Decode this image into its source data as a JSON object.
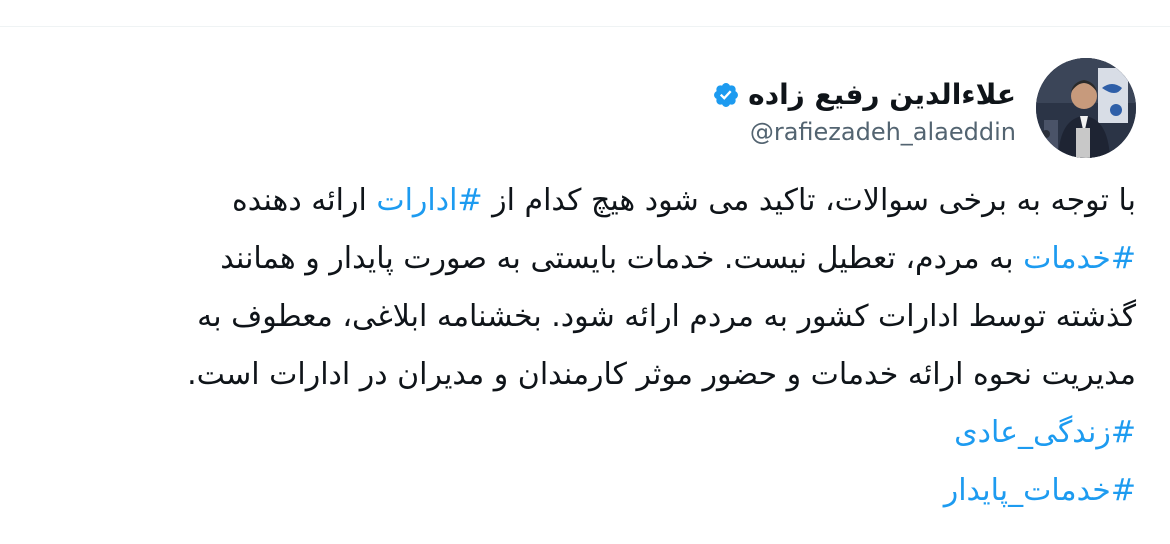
{
  "author": {
    "name": "علاءالدین رفیع زاده",
    "handle": "@rafiezadeh_alaeddin",
    "verified": true,
    "avatar_icon": "profile-photo"
  },
  "colors": {
    "link": "#1d9bf0",
    "verified_badge": "#1d9bf0",
    "handle": "#536471",
    "text": "#0f1419"
  },
  "tweet": {
    "line1": {
      "a": "با توجه به برخی سوالات، تاکید می شود هیچ کدام از ",
      "tag": "#ادارات",
      "b": " ارائه دهنده"
    },
    "line2": {
      "tag": "#خدمات",
      "b": " به مردم، تعطیل نیست. خدمات بایستی به صورت پایدار و همانند"
    },
    "line3": "گذشته توسط ادارات کشور به مردم ارائه شود. بخشنامه ابلاغی، معطوف به",
    "line4": "مدیریت نحوه ارائه خدمات و حضور موثر کارمندان و مدیران در ادارات است.",
    "hashtag1": "#زندگی_عادی",
    "hashtag2": "#خدمات_پایدار"
  }
}
